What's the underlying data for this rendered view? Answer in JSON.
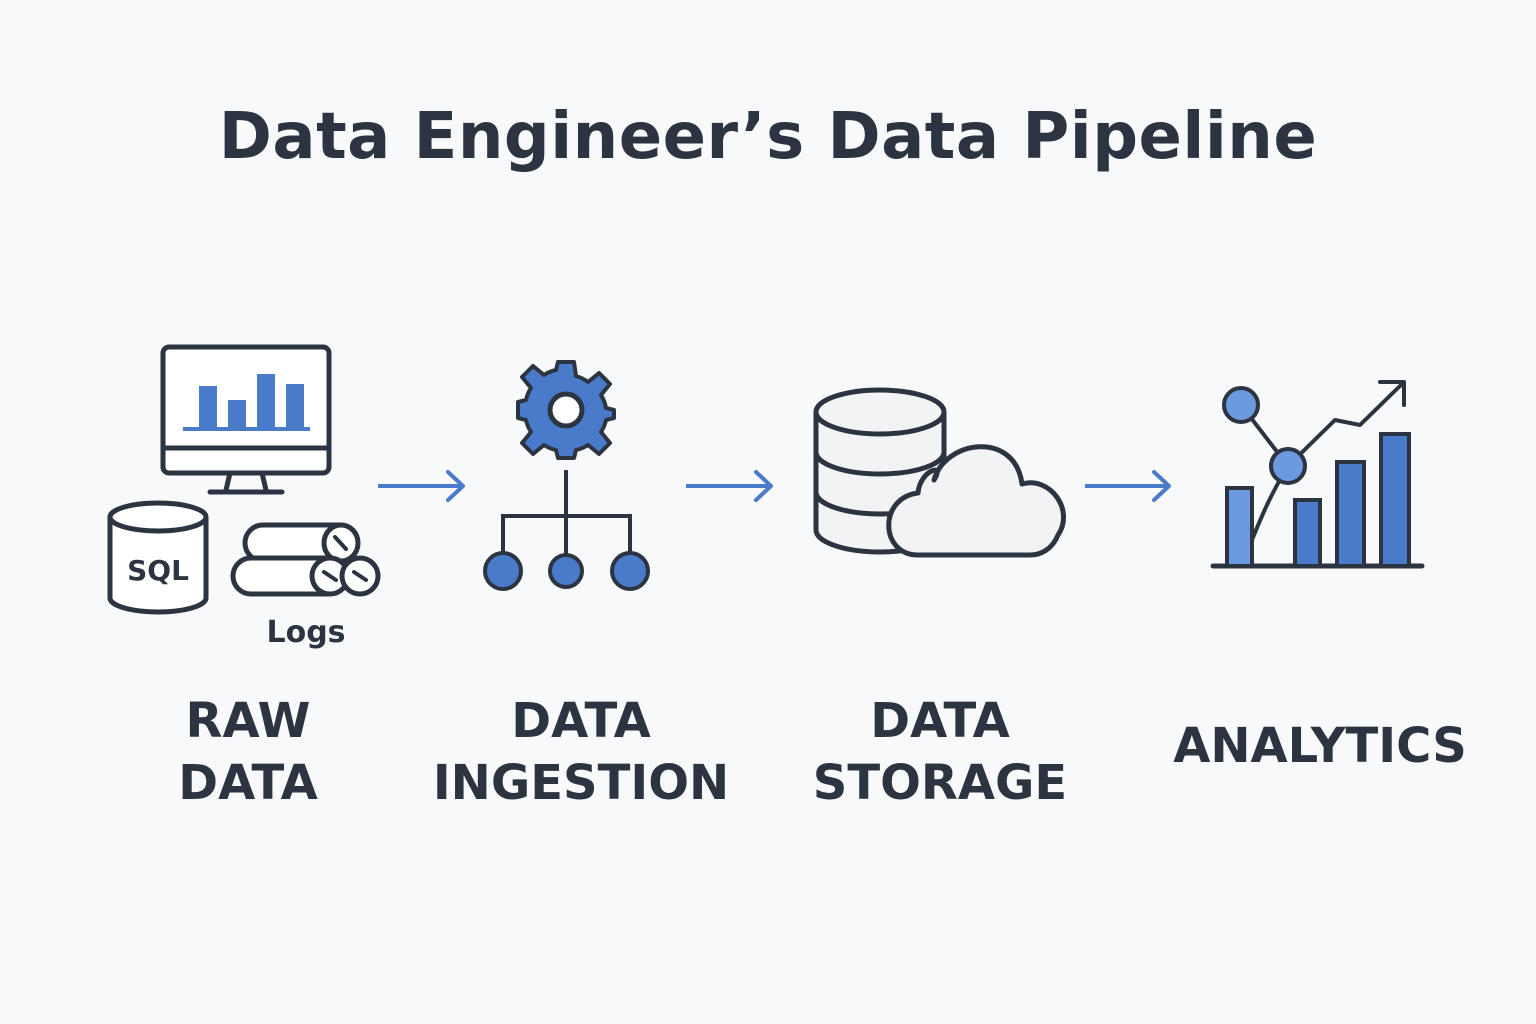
{
  "title": "Data Engineer’s Data Pipeline",
  "colors": {
    "background": "#f8f9fa",
    "outline": "#2b3440",
    "accent": "#4a7bcb",
    "accent_light": "#6b9adf",
    "fill_light": "#f1f3f5"
  },
  "stages": [
    {
      "id": "raw-data",
      "label_lines": [
        "RAW",
        "DATA"
      ],
      "icons": [
        "monitor-bar-chart-icon",
        "sql-database-icon",
        "logs-stack-icon"
      ],
      "sql_label": "SQL",
      "logs_label": "Logs"
    },
    {
      "id": "data-ingestion",
      "label_lines": [
        "DATA",
        "INGESTION"
      ],
      "icons": [
        "gear-icon",
        "hierarchy-icon"
      ]
    },
    {
      "id": "data-storage",
      "label_lines": [
        "DATA",
        "STORAGE"
      ],
      "icons": [
        "database-icon",
        "cloud-icon"
      ]
    },
    {
      "id": "analytics",
      "label_lines": [
        "ANALYTICS"
      ],
      "icons": [
        "bar-chart-trend-icon"
      ]
    }
  ],
  "connectors": [
    "arrow-right-icon",
    "arrow-right-icon",
    "arrow-right-icon"
  ]
}
